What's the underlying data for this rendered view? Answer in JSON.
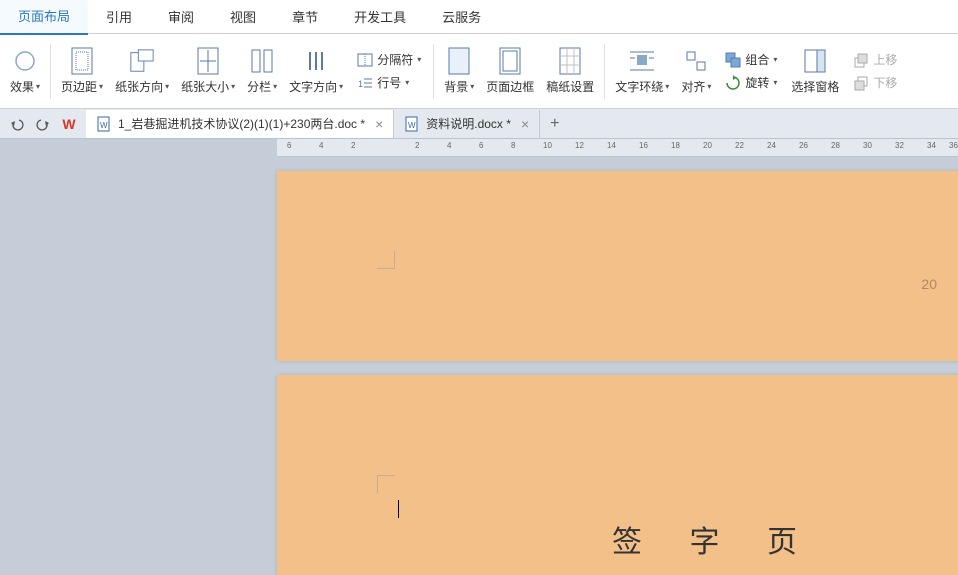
{
  "menu": {
    "items": [
      "页面布局",
      "引用",
      "审阅",
      "视图",
      "章节",
      "开发工具",
      "云服务"
    ],
    "active": 0
  },
  "ribbon": {
    "effect": "效果",
    "margin": "页边距",
    "orient": "纸张方向",
    "size": "纸张大小",
    "columns": "分栏",
    "textdir": "文字方向",
    "separator": "分隔符",
    "linenum": "行号",
    "background": "背景",
    "border": "页面边框",
    "grid": "稿纸设置",
    "wrap": "文字环绕",
    "align": "对齐",
    "rotate": "旋转",
    "group": "组合",
    "selpane": "选择窗格",
    "moveup": "上移",
    "movedown": "下移"
  },
  "tabs": {
    "doc1": "1_岩巷掘进机技术协议(2)(1)(1)+230两台.doc *",
    "doc2": "资料说明.docx *"
  },
  "ruler_ticks": [
    "6",
    "4",
    "2",
    "2",
    "4",
    "6",
    "8",
    "10",
    "12",
    "14",
    "16",
    "18",
    "20",
    "22",
    "24",
    "26",
    "28",
    "30",
    "32",
    "34",
    "36"
  ],
  "page": {
    "number": "20",
    "heading": "签  字  页"
  }
}
